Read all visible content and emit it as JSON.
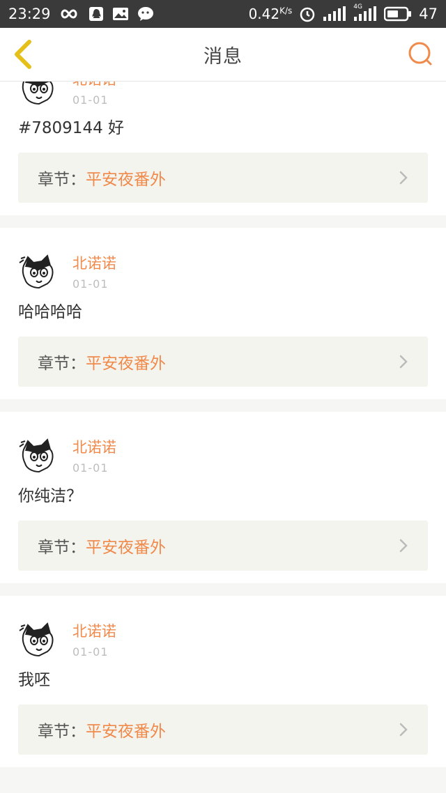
{
  "status_bar": {
    "time": "23:29",
    "speed": "0.42",
    "speed_unit": "K/s",
    "battery": "47",
    "network": "4G"
  },
  "nav": {
    "title": "消息"
  },
  "comments": [
    {
      "user": "北诺诺",
      "date": "01-01",
      "text": "#7809144 好",
      "chapter_label": "章节：",
      "chapter_title": "平安夜番外"
    },
    {
      "user": "北诺诺",
      "date": "01-01",
      "text": "哈哈哈哈",
      "chapter_label": "章节：",
      "chapter_title": "平安夜番外"
    },
    {
      "user": "北诺诺",
      "date": "01-01",
      "text": "你纯洁？",
      "chapter_label": "章节：",
      "chapter_title": "平安夜番外"
    },
    {
      "user": "北诺诺",
      "date": "01-01",
      "text": "我呸",
      "chapter_label": "章节：",
      "chapter_title": "平安夜番外"
    }
  ],
  "colors": {
    "accent": "#f08a4b",
    "status_bar_bg": "#3a3a3a",
    "background": "#f6f6f4"
  },
  "icons": {
    "back": "chevron-left-icon",
    "search": "search-icon",
    "avatar": "cat-avatar-icon",
    "arrow": "chevron-right-icon"
  }
}
